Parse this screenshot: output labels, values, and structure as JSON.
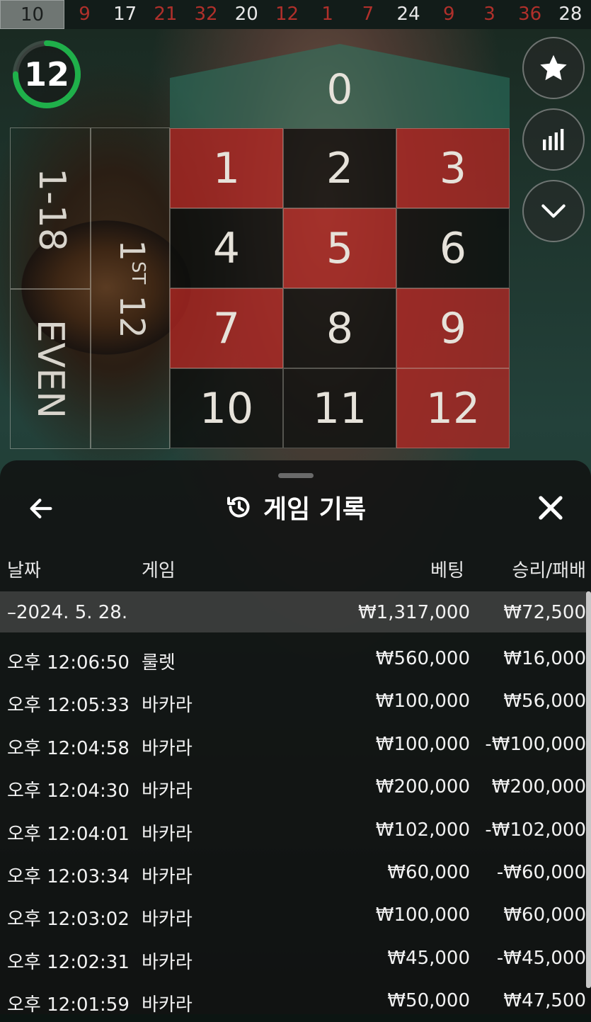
{
  "recent_results": [
    {
      "value": "10",
      "color": "gray"
    },
    {
      "value": "9",
      "color": "red"
    },
    {
      "value": "17",
      "color": "white"
    },
    {
      "value": "21",
      "color": "red"
    },
    {
      "value": "32",
      "color": "red"
    },
    {
      "value": "20",
      "color": "white"
    },
    {
      "value": "12",
      "color": "red"
    },
    {
      "value": "1",
      "color": "red"
    },
    {
      "value": "7",
      "color": "red"
    },
    {
      "value": "24",
      "color": "white"
    },
    {
      "value": "9",
      "color": "red"
    },
    {
      "value": "3",
      "color": "red"
    },
    {
      "value": "36",
      "color": "red"
    },
    {
      "value": "28",
      "color": "white"
    }
  ],
  "timer": {
    "seconds": "12",
    "progress": 0.75,
    "color": "#1fb04a"
  },
  "table": {
    "zero": "0",
    "numbers": [
      {
        "n": "1",
        "c": "red"
      },
      {
        "n": "2",
        "c": "black"
      },
      {
        "n": "3",
        "c": "red"
      },
      {
        "n": "4",
        "c": "black"
      },
      {
        "n": "5",
        "c": "red"
      },
      {
        "n": "6",
        "c": "black"
      },
      {
        "n": "7",
        "c": "red"
      },
      {
        "n": "8",
        "c": "black"
      },
      {
        "n": "9",
        "c": "red"
      },
      {
        "n": "10",
        "c": "black"
      },
      {
        "n": "11",
        "c": "black"
      },
      {
        "n": "12",
        "c": "red"
      }
    ],
    "outside_low": "1-18",
    "outside_even": "EVEN",
    "dozen": {
      "main": "1",
      "suffix": "ST",
      "tail": "12"
    }
  },
  "side_buttons": [
    "star-icon",
    "stats-icon",
    "chevron-down-icon"
  ],
  "panel": {
    "title": "게임 기록",
    "columns": {
      "date": "날짜",
      "game": "게임",
      "bet": "베팅",
      "win_loss": "승리/패배"
    },
    "date_group": {
      "date": "–2024. 5. 28.",
      "bet": "₩1,317,000",
      "win_loss": "₩72,500"
    },
    "rows": [
      {
        "time": "오후 12:06:50",
        "game": "룰렛",
        "bet": "₩560,000",
        "win_loss": "₩16,000"
      },
      {
        "time": "오후 12:05:33",
        "game": "바카라",
        "bet": "₩100,000",
        "win_loss": "₩56,000"
      },
      {
        "time": "오후 12:04:58",
        "game": "바카라",
        "bet": "₩100,000",
        "win_loss": "-₩100,000"
      },
      {
        "time": "오후 12:04:30",
        "game": "바카라",
        "bet": "₩200,000",
        "win_loss": "₩200,000"
      },
      {
        "time": "오후 12:04:01",
        "game": "바카라",
        "bet": "₩102,000",
        "win_loss": "-₩102,000"
      },
      {
        "time": "오후 12:03:34",
        "game": "바카라",
        "bet": "₩60,000",
        "win_loss": "-₩60,000"
      },
      {
        "time": "오후 12:03:02",
        "game": "바카라",
        "bet": "₩100,000",
        "win_loss": "₩60,000"
      },
      {
        "time": "오후 12:02:31",
        "game": "바카라",
        "bet": "₩45,000",
        "win_loss": "-₩45,000"
      },
      {
        "time": "오후 12:01:59",
        "game": "바카라",
        "bet": "₩50,000",
        "win_loss": "₩47,500"
      }
    ]
  }
}
